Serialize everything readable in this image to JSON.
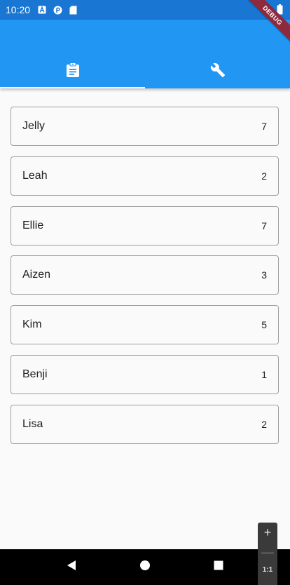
{
  "status_bar": {
    "time": "10:20",
    "left_icons": [
      "a-letter-icon",
      "p-circle-icon",
      "sd-card-icon"
    ],
    "right_icons": [
      "wifi-icon",
      "battery-icon"
    ]
  },
  "debug_banner": {
    "label": "DEBUG"
  },
  "tabs": [
    {
      "icon": "clipboard-icon",
      "selected": true
    },
    {
      "icon": "wrench-icon",
      "selected": false
    }
  ],
  "items": [
    {
      "name": "Jelly",
      "count": "7"
    },
    {
      "name": "Leah",
      "count": "2"
    },
    {
      "name": "Ellie",
      "count": "7"
    },
    {
      "name": "Aizen",
      "count": "3"
    },
    {
      "name": "Kim",
      "count": "5"
    },
    {
      "name": "Benji",
      "count": "1"
    },
    {
      "name": "Lisa",
      "count": "2"
    }
  ],
  "zoom": {
    "plus": "+",
    "minus": "—",
    "ratio": "1:1"
  },
  "colors": {
    "status_bar": "#1976d2",
    "app_bar": "#2196f3",
    "card_border": "#9e9e9e",
    "background": "#fafafa"
  }
}
